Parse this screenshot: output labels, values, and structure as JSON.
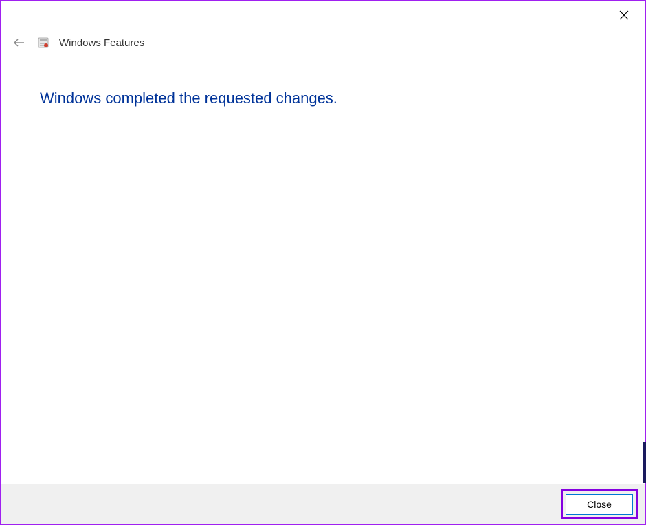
{
  "header": {
    "title": "Windows Features"
  },
  "main": {
    "message": "Windows completed the requested changes."
  },
  "footer": {
    "close_label": "Close"
  }
}
